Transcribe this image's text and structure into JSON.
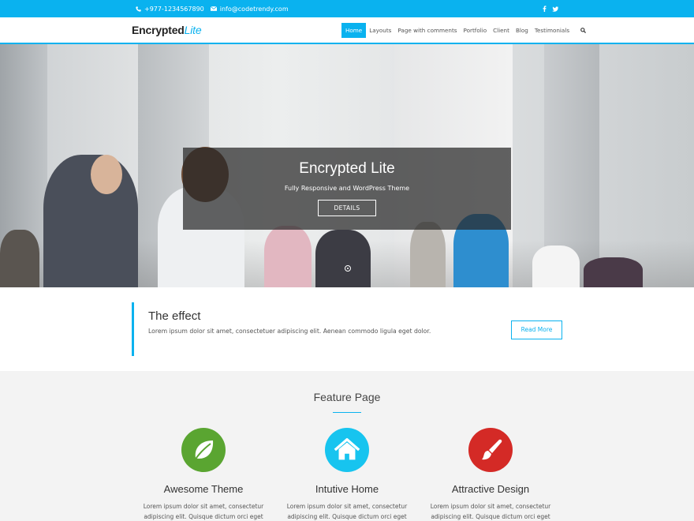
{
  "topbar": {
    "phone": "+977-1234567890",
    "email": "info@codetrendy.com",
    "social": [
      "facebook-icon",
      "twitter-icon"
    ]
  },
  "header": {
    "logo_main": "Encrypted",
    "logo_accent": "Lite",
    "nav": [
      {
        "label": "Home",
        "active": true
      },
      {
        "label": "Layouts"
      },
      {
        "label": "Page with comments"
      },
      {
        "label": "Portfolio"
      },
      {
        "label": "Client"
      },
      {
        "label": "Blog"
      },
      {
        "label": "Testimonials"
      }
    ]
  },
  "hero": {
    "title": "Encrypted Lite",
    "subtitle": "Fully Responsive and WordPress Theme",
    "button": "DETAILS"
  },
  "effect": {
    "title": "The effect",
    "text": "Lorem ipsum dolor sit amet, consectetuer adipiscing elit. Aenean commodo ligula eget dolor.",
    "button": "Read More"
  },
  "features": {
    "title": "Feature Page",
    "items": [
      {
        "title": "Awesome Theme",
        "text": "Lorem ipsum dolor sit amet, consectetur adipiscing elit. Quisque dictum orci eget dignissim",
        "icon": "leaf-icon",
        "color": "#5aa531"
      },
      {
        "title": "Intutive Home",
        "text": "Lorem ipsum dolor sit amet, consectetur adipiscing elit. Quisque dictum orci eget dignissim",
        "icon": "home-icon",
        "color": "#17c4ef"
      },
      {
        "title": "Attractive Design",
        "text": "Lorem ipsum dolor sit amet, consectetur adipiscing elit. Quisque dictum orci eget dignissim",
        "icon": "paintbrush-icon",
        "color": "#d42a26"
      }
    ]
  },
  "colors": {
    "accent": "#0ab2ef"
  }
}
